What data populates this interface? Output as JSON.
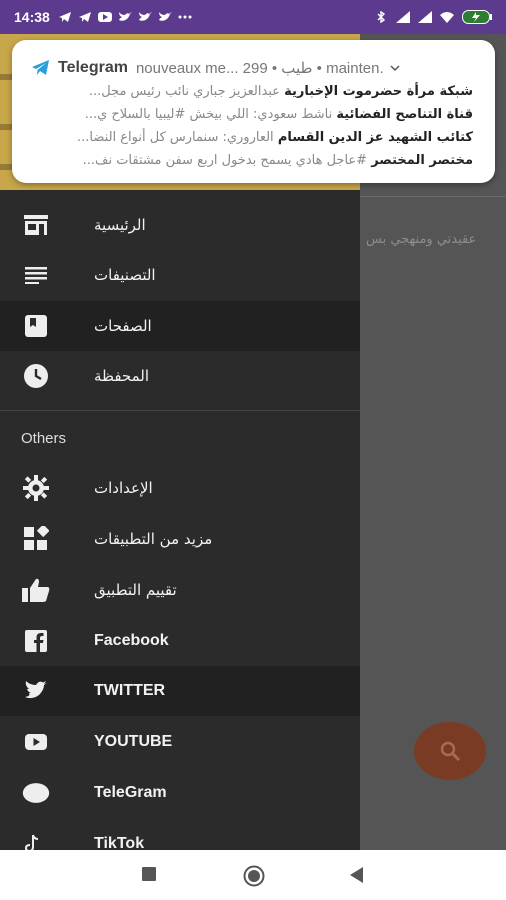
{
  "status_bar": {
    "time": "14:38",
    "left_icons": [
      "telegram-icon",
      "telegram-icon",
      "youtube-icon",
      "twitter-icon",
      "twitter-icon",
      "twitter-icon",
      "more-dots-icon"
    ],
    "right_icons": [
      "bluetooth-icon",
      "signal-icon",
      "signal-icon",
      "wifi-icon",
      "battery-icon"
    ],
    "color": "#5c3b8e"
  },
  "notification": {
    "app": "Telegram",
    "subtitle": "nouveaux me... 299 • طيب • mainten.",
    "lines": [
      {
        "bold": "شبكة مرأة حضرموت الإخبارية",
        "text": "عبدالعزيز جباري نائب رئيس مجل..."
      },
      {
        "bold": "قناة التناصح الفضائية",
        "text": "ناشط سعودي: اللي بيخش #ليبيا بالسلاح ي..."
      },
      {
        "bold": "كتائب الشهيد عز الدين القسام",
        "text": "العاروري: سنمارس كل أنواع النضا..."
      },
      {
        "bold": "مختصر المختصر",
        "text": "#عاجل هادي يسمح بدخول اربع سفن مشتقات نف..."
      }
    ]
  },
  "background": {
    "snippet": "عقيدتي ومنهجي بس",
    "fab_color": "#7a3b25"
  },
  "drawer": {
    "items": [
      {
        "label": "الرئيسية",
        "icon": "store-icon"
      },
      {
        "label": "التصنيفات",
        "icon": "list-icon"
      },
      {
        "label": "الصفحات",
        "icon": "bookmark-page-icon"
      },
      {
        "label": "المحفظة",
        "icon": "clock-icon"
      }
    ],
    "section_title": "Others",
    "others": [
      {
        "label": "الإعدادات",
        "icon": "gear-icon"
      },
      {
        "label": "مزيد من التطبيقات",
        "icon": "apps-icon"
      },
      {
        "label": "تقييم التطبيق",
        "icon": "thumbs-up-icon"
      },
      {
        "label": "Facebook",
        "icon": "facebook-icon"
      },
      {
        "label": "TWITTER",
        "icon": "twitter-icon"
      },
      {
        "label": "YOUTUBE",
        "icon": "youtube-icon"
      },
      {
        "label": "TeleGram",
        "icon": "telegram-circle-icon"
      },
      {
        "label": "TikTok",
        "icon": "tiktok-icon"
      }
    ]
  },
  "nav_bar": [
    "recents-icon",
    "home-icon",
    "back-icon"
  ]
}
